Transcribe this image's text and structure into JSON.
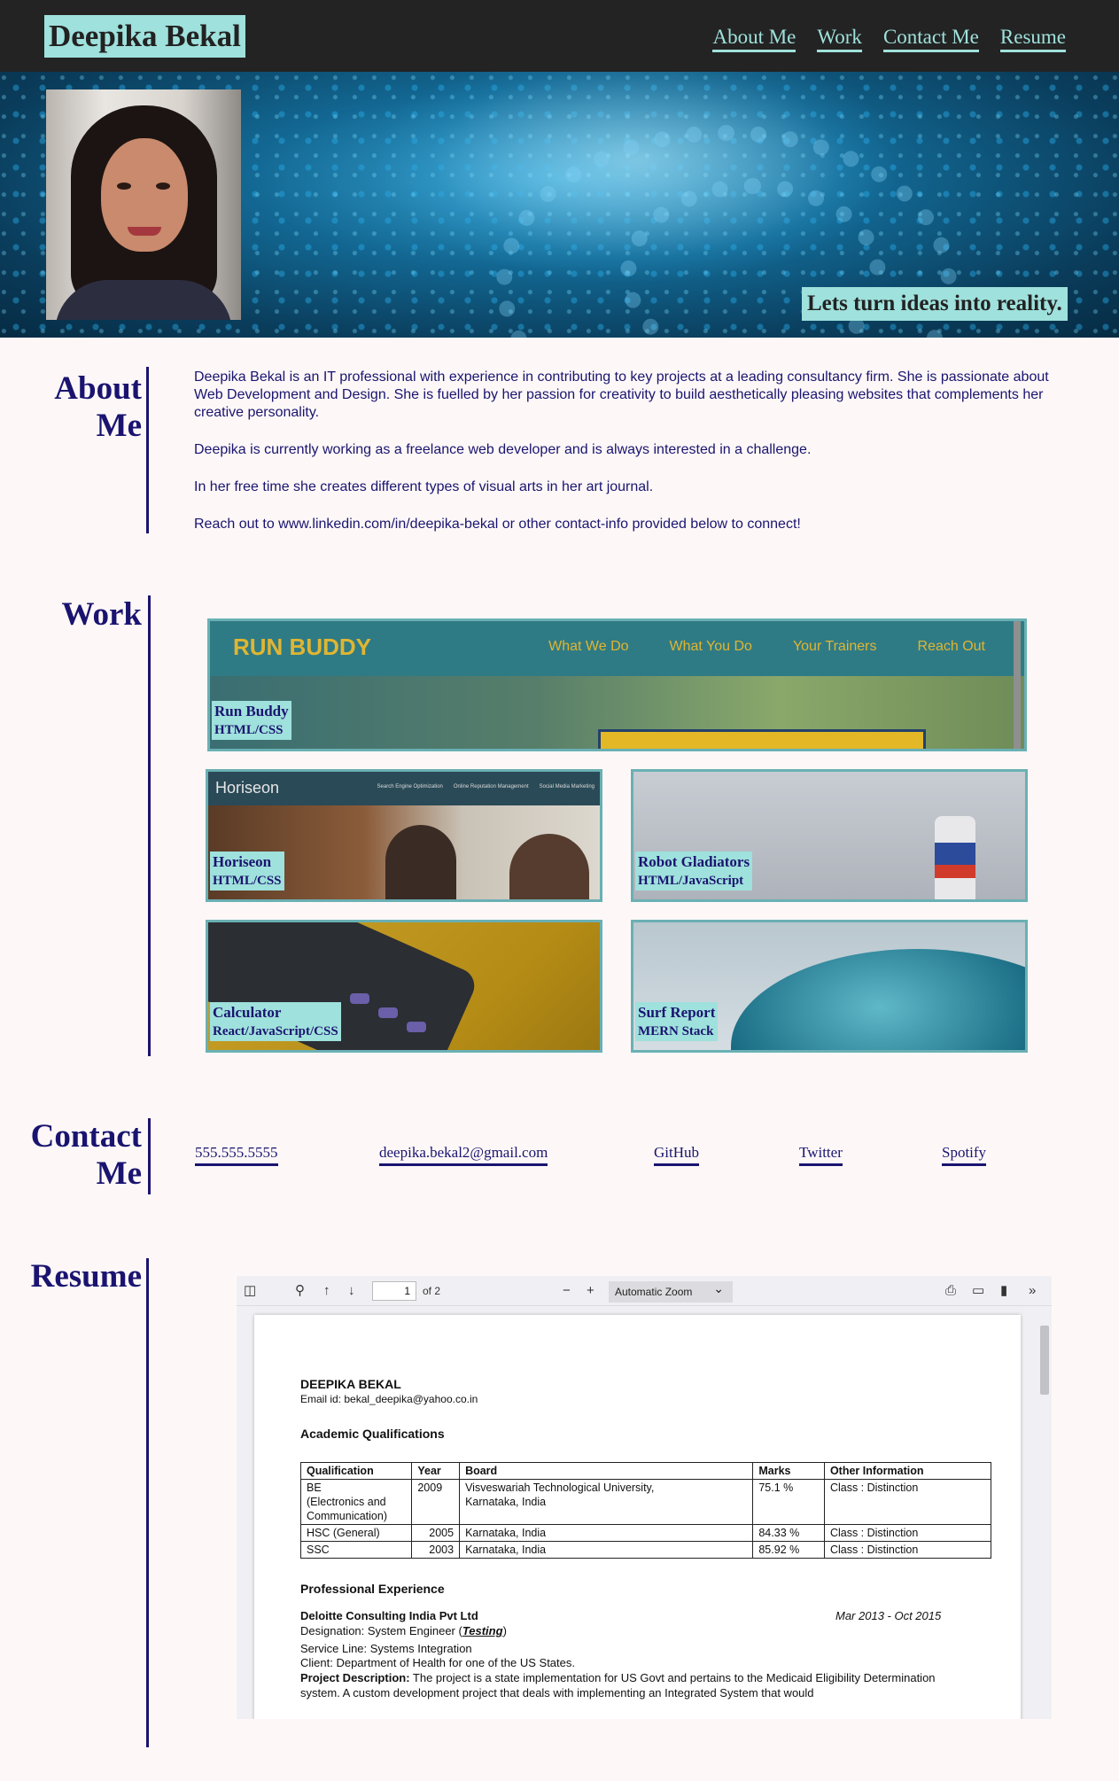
{
  "header": {
    "brand": "Deepika Bekal",
    "nav": [
      "About Me",
      "Work",
      "Contact Me",
      "Resume"
    ]
  },
  "hero": {
    "tagline": "Lets turn ideas into reality."
  },
  "about": {
    "title": "About Me",
    "paragraphs": [
      "Deepika Bekal is an IT professional with experience in contributing to key projects at a leading consultancy firm. She is passionate about Web Development and Design. She is fuelled by her passion for creativity to build aesthetically pleasing websites that complements her creative personality.",
      "Deepika is currently working as a freelance web developer and is always interested in a challenge.",
      "In her free time she creates different types of visual arts in her art journal.",
      "Reach out to www.linkedin.com/in/deepika-bekal or other contact-info provided below to connect!"
    ]
  },
  "work": {
    "title": "Work",
    "projects": [
      {
        "name": "Run Buddy",
        "tech": "HTML/CSS",
        "preview_logo": "RUN BUDDY",
        "preview_links": [
          "What We Do",
          "What You Do",
          "Your Trainers",
          "Reach Out"
        ]
      },
      {
        "name": "Horiseon",
        "tech": "HTML/CSS",
        "preview_logo": "Horiseon",
        "preview_links": [
          "Search Engine Optimization",
          "Online Reputation Management",
          "Social Media Marketing"
        ]
      },
      {
        "name": "Robot Gladiators",
        "tech": "HTML/JavaScript"
      },
      {
        "name": "Calculator",
        "tech": "React/JavaScript/CSS"
      },
      {
        "name": "Surf Report",
        "tech": "MERN Stack"
      }
    ]
  },
  "contact": {
    "title": "Contact Me",
    "links": [
      "555.555.5555",
      "deepika.bekal2@gmail.com",
      "GitHub",
      "Twitter",
      "Spotify"
    ]
  },
  "resume": {
    "title": "Resume",
    "viewer": {
      "page_number": "1",
      "page_of": "of 2",
      "zoom": "Automatic Zoom"
    },
    "document": {
      "name": "DEEPIKA BEKAL",
      "email": "Email id: bekal_deepika@yahoo.co.in",
      "academic_heading": "Academic Qualifications",
      "table_headers": [
        "Qualification",
        "Year",
        "Board",
        "Marks",
        "Other Information"
      ],
      "table_rows": [
        [
          "BE\n(Electronics and\nCommunication)",
          "2009",
          "Visveswariah Technological University,\nKarnataka, India",
          "75.1 %",
          "Class : Distinction"
        ],
        [
          "HSC (General)",
          "2005",
          "Karnataka, India",
          "84.33 %",
          "Class : Distinction"
        ],
        [
          "SSC",
          "2003",
          "Karnataka, India",
          "85.92 %",
          "Class : Distinction"
        ]
      ],
      "experience_heading": "Professional Experience",
      "company": "Deloitte Consulting India Pvt Ltd",
      "dates": "Mar 2013 - Oct 2015",
      "designation_prefix": "Designation: System Engineer (",
      "designation_role": "Testing",
      "designation_suffix": ")",
      "service_line": "Service Line: Systems Integration",
      "client": "Client: Department of Health for one of the US States.",
      "project_label": "Project Description:",
      "project_text": " The project is a state implementation for US Govt and pertains to the Medicaid Eligibility Determination system. A custom development project that deals with implementing an Integrated System that would"
    }
  }
}
